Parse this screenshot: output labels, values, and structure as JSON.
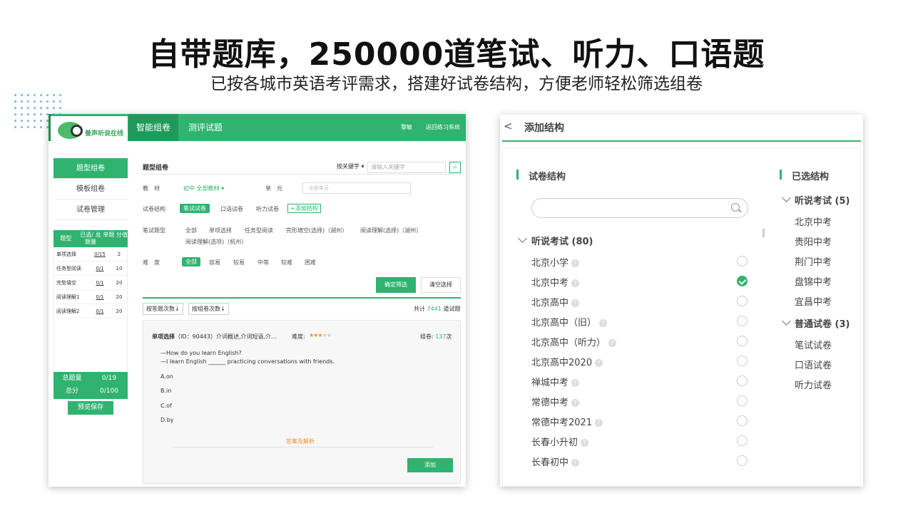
{
  "slide": {
    "headline": "自带题库，250000道笔试、听力、口语题",
    "subline": "已按各城市英语考评需求，搭建好试卷结构，方便老师轻松筛选组卷"
  },
  "left_window": {
    "logo_text": "普声听说在线",
    "tabs": {
      "active": "智能组卷",
      "other": "测评试题"
    },
    "top_user": "黎敏",
    "top_back": "返回练习系统",
    "sidenav": [
      "题型组卷",
      "模板组卷",
      "试卷管理"
    ],
    "stats": {
      "headers": [
        "题型",
        "已选/ 总题量",
        "单题 分值"
      ],
      "rows": [
        {
          "type": "单项选择",
          "selected": "0/15",
          "score": "2"
        },
        {
          "type": "任务型阅读",
          "selected": "0/1",
          "score": "10"
        },
        {
          "type": "完型填空",
          "selected": "0/1",
          "score": "20"
        },
        {
          "type": "阅读理解1",
          "selected": "0/1",
          "score": "20"
        },
        {
          "type": "阅读理解2",
          "selected": "0/1",
          "score": "20"
        }
      ],
      "total_count_label": "总题量",
      "total_count": "0/19",
      "total_score_label": "总分",
      "total_score": "0/100"
    },
    "preview_save": "预览保存",
    "main": {
      "title": "题型组卷",
      "keyword_select": "按关键字 ▾",
      "keyword_placeholder": "请输入关键字",
      "search_icon": "search-icon",
      "textbook_label": "教　材",
      "textbook_value": "初中 全部教材 ▾",
      "unit_label": "单　元",
      "unit_placeholder": "全部单元",
      "structure_label": "试卷结构",
      "structures": [
        "笔试试卷",
        "口语试卷",
        "听力试卷"
      ],
      "add_structure": "+添加结构",
      "type_label": "笔试题型",
      "types_row1": [
        "全部",
        "单项选择",
        "任务型阅读",
        "完形填空(选择)（湖州）",
        "阅读理解(选择)（湖州）"
      ],
      "types_row2": [
        "阅读理解(选项)（杭州）"
      ],
      "difficulty_label": "难　度",
      "difficulties": [
        "全部",
        "容易",
        "较易",
        "中等",
        "较难",
        "困难"
      ],
      "confirm": "确定筛选",
      "clear": "清空选择",
      "sort_by_answer": "按答题次数↓",
      "sort_by_compose": "按组卷次数↓",
      "count_prefix": "共计",
      "count_value": "7441",
      "count_suffix": "道试题",
      "question": {
        "type": "单项选择",
        "meta": "（ID：90443）介词概述,介词短语,介...",
        "difficulty_label": "难度:",
        "used_prefix": "组卷:",
        "used_value": "137",
        "used_suffix": "次",
        "stem1": "—How do you learn English?",
        "stem2": "—I learn English ______ practicing conversations with friends.",
        "options": [
          "A.on",
          "B.in",
          "C.of",
          "D.by"
        ],
        "answer_link": "答案及解析",
        "add": "添加"
      }
    }
  },
  "right_window": {
    "back": "<",
    "title": "添加结构",
    "structure_title": "试卷结构",
    "selected_title": "已选结构",
    "search_icon": "search-icon",
    "group_title": "听说考试 (80)",
    "items": [
      {
        "label": "北京小学",
        "checked": false
      },
      {
        "label": "北京中考",
        "checked": true
      },
      {
        "label": "北京高中",
        "checked": false
      },
      {
        "label": "北京高中（旧）",
        "checked": false
      },
      {
        "label": "北京高中（听力）",
        "checked": false
      },
      {
        "label": "北京高中2020",
        "checked": false
      },
      {
        "label": "禅城中考",
        "checked": false
      },
      {
        "label": "常德中考",
        "checked": false
      },
      {
        "label": "常德中考2021",
        "checked": false
      },
      {
        "label": "长春小升初",
        "checked": false
      },
      {
        "label": "长春初中",
        "checked": false
      }
    ],
    "selected_groups": [
      {
        "title": "听说考试 (5)",
        "items": [
          "北京中考",
          "贵阳中考",
          "荆门中考",
          "盘锦中考",
          "宜昌中考"
        ]
      },
      {
        "title": "普通试卷 (3)",
        "items": [
          "笔试试卷",
          "口语试卷",
          "听力试卷"
        ]
      }
    ],
    "colors": {
      "accent": "#2fb36f"
    }
  }
}
